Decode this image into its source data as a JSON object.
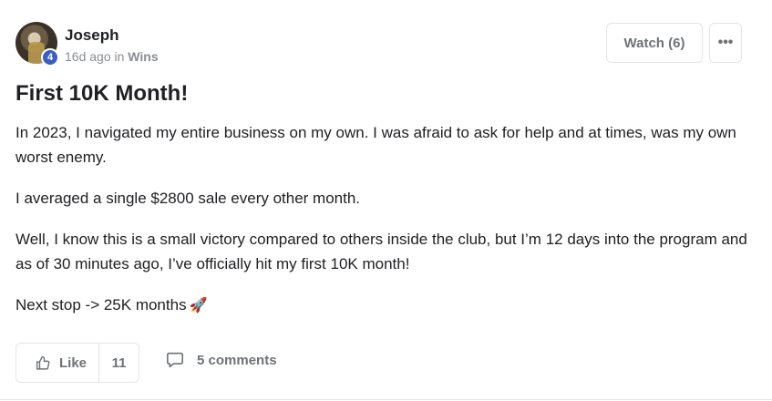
{
  "author": {
    "name": "Joseph",
    "level": "4",
    "time_ago": "16d ago",
    "in_label": "in",
    "category": "Wins"
  },
  "actions": {
    "watch_label": "Watch (6)",
    "more_label": "•••"
  },
  "post": {
    "title": "First 10K Month!",
    "paragraphs": [
      "In 2023, I navigated my entire business on my own. I was afraid to ask for help and at times, was my own worst enemy.",
      "I averaged a single $2800 sale every other month.",
      "Well, I know this is a small victory compared to others inside the club, but I’m 12 days into the program and as of 30 minutes ago, I’ve officially hit my first 10K month!",
      "Next stop -> 25K months"
    ],
    "emoji": "🚀"
  },
  "footer": {
    "like_label": "Like",
    "like_count": "11",
    "comments_label": "5 comments"
  },
  "colors": {
    "badge": "#3b5fc1",
    "muted": "#6f7276",
    "border": "#e4e5e7",
    "text": "#202124"
  }
}
